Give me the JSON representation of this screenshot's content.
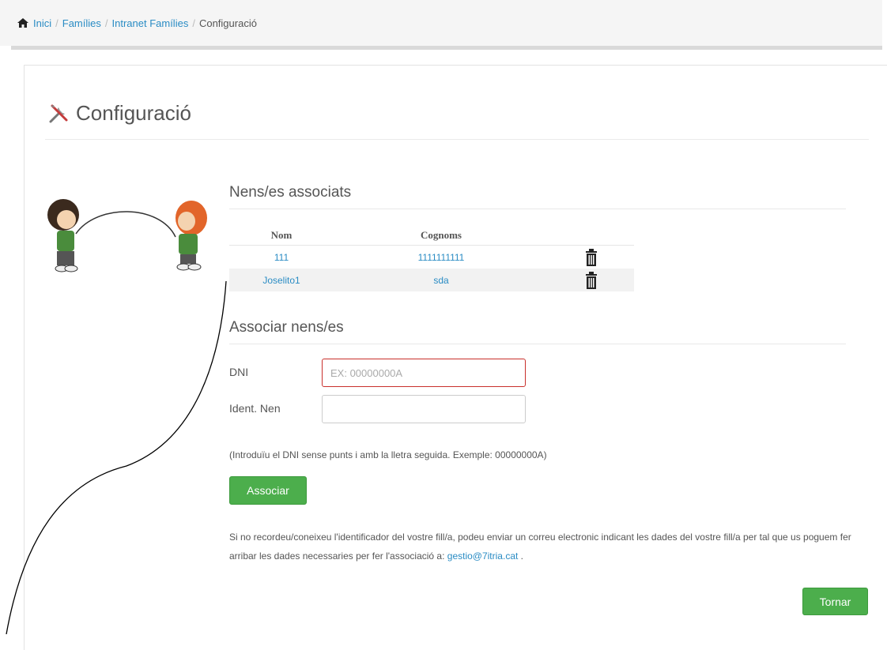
{
  "breadcrumb": {
    "items": [
      {
        "label": "Inici"
      },
      {
        "label": "Famílies"
      },
      {
        "label": "Intranet Famílies"
      }
    ],
    "current": "Configuració",
    "separator": "/"
  },
  "page": {
    "title": "Configuració"
  },
  "associated": {
    "heading": "Nens/es associats",
    "columns": [
      "Nom",
      "Cognoms"
    ],
    "rows": [
      {
        "nom": "111",
        "cognoms": "1111111111"
      },
      {
        "nom": "Joselito1",
        "cognoms": "sda"
      }
    ]
  },
  "associate_form": {
    "heading": "Associar nens/es",
    "dni_label": "DNI",
    "dni_placeholder": "EX: 00000000A",
    "ident_label": "Ident. Nen",
    "ident_value": "",
    "hint": "(Introduïu el DNI sense punts i amb la lletra seguida. Exemple: 00000000A)",
    "submit_label": "Associar"
  },
  "info": {
    "text": "Si no recordeu/coneixeu l'identificador del vostre fill/a, podeu enviar un correu electronic indicant les dades del vostre fill/a per tal que us poguem fer arribar les dades necessaries per fer l'associació a: ",
    "email": "gestio@7itria.cat",
    "trailing": "."
  },
  "back_button": {
    "label": "Tornar"
  },
  "colors": {
    "link": "#2a8cc4",
    "success": "#4cae4c",
    "error_border": "#c9302c"
  }
}
